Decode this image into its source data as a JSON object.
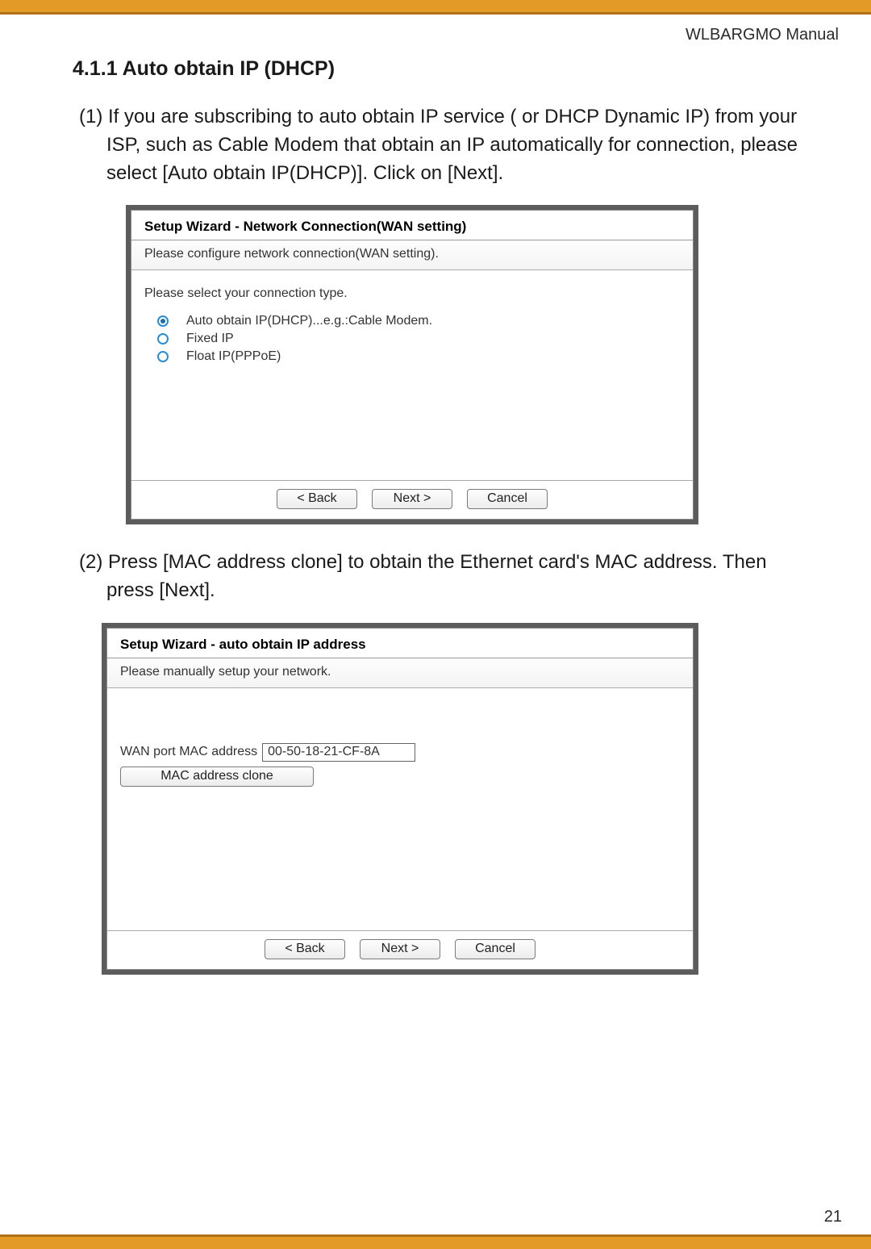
{
  "header": {
    "manual_label": "WLBARGMO Manual"
  },
  "section": {
    "number_title": "4.1.1 Auto obtain IP (DHCP)"
  },
  "steps": {
    "s1": "(1) If you are subscribing to auto obtain IP service ( or DHCP Dynamic IP) from your ISP, such as Cable Modem that obtain an IP automatically for connection, please select [Auto obtain IP(DHCP)]. Click on [Next].",
    "s2": "(2) Press [MAC address clone] to obtain the Ethernet card's MAC address. Then press [Next]."
  },
  "wizard1": {
    "title": "Setup Wizard - Network Connection(WAN setting)",
    "desc": "Please configure network connection(WAN setting).",
    "prompt": "Please select your connection type.",
    "options": {
      "o1": "Auto obtain IP(DHCP)...e.g.:Cable Modem.",
      "o2": "Fixed IP",
      "o3": "Float IP(PPPoE)"
    },
    "buttons": {
      "back": "< Back",
      "next": "Next >",
      "cancel": "Cancel"
    }
  },
  "wizard2": {
    "title": "Setup Wizard - auto obtain IP address",
    "desc": "Please manually setup your network.",
    "mac_label": "WAN port MAC address",
    "mac_value": "00-50-18-21-CF-8A",
    "clone_label": "MAC address clone",
    "buttons": {
      "back": "< Back",
      "next": "Next >",
      "cancel": "Cancel"
    }
  },
  "page_number": "21"
}
